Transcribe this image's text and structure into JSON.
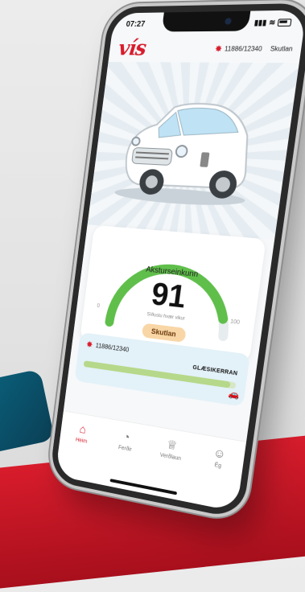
{
  "status": {
    "time": "07:27"
  },
  "app": {
    "logo": "vís"
  },
  "header": {
    "points": "11886/12340",
    "level": "Skutlan"
  },
  "score": {
    "label": "Aksturseinkunn",
    "value": "91",
    "sub": "Síðustu hvær vikur",
    "min": "0",
    "max": "100",
    "fraction": 0.91,
    "badge": "Skutlan"
  },
  "progress": {
    "points": "11886/12340",
    "next_level": "GLÆSIKERRAN",
    "fraction": 0.963
  },
  "tabs": [
    {
      "label": "Heim",
      "icon": "home-icon"
    },
    {
      "label": "Ferðir",
      "icon": "speedometer-icon"
    },
    {
      "label": "Verðlaun",
      "icon": "trophy-icon"
    },
    {
      "label": "Ég",
      "icon": "user-icon"
    }
  ],
  "colors": {
    "brand": "#d81c2c",
    "gauge": "#5fbf4a",
    "badge": "#f9d6a6"
  }
}
